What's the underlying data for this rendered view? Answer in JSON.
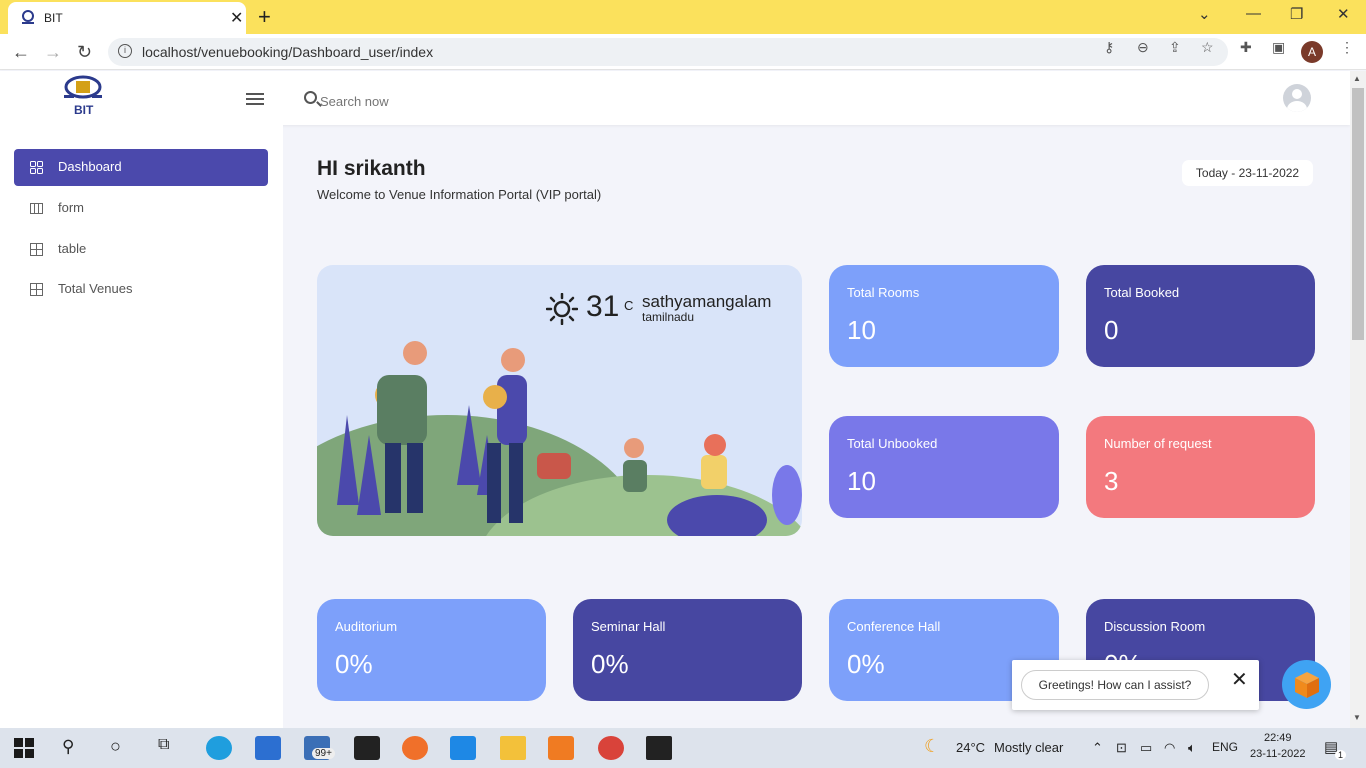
{
  "browser": {
    "tab_title": "BIT",
    "tab_close": "✕",
    "new_tab": "+",
    "url": "localhost/venuebooking/Dashboard_user/index",
    "profile_initial": "A"
  },
  "header": {
    "logo_text": "BIT",
    "search_placeholder": "Search now"
  },
  "sidebar": {
    "items": [
      {
        "label": "Dashboard",
        "icon": "grid-icon",
        "active": true
      },
      {
        "label": "form",
        "icon": "columns-icon"
      },
      {
        "label": "table",
        "icon": "table-grid-icon"
      },
      {
        "label": "Total Venues",
        "icon": "table-grid-icon"
      }
    ]
  },
  "main": {
    "greeting": "HI srikanth",
    "welcome": "Welcome to Venue Information Portal (VIP portal)",
    "date_badge": "Today - 23-11-2022",
    "weather": {
      "temp": "31",
      "unit": "C",
      "city": "sathyamangalam",
      "state": "tamilnadu",
      "icon": "sun-icon"
    },
    "stats": [
      {
        "title": "Total Rooms",
        "value": "10",
        "color": "#7da0fa"
      },
      {
        "title": "Total Booked",
        "value": "0",
        "color": "#4747a1"
      },
      {
        "title": "Total Unbooked",
        "value": "10",
        "color": "#7978e9"
      },
      {
        "title": "Number of request",
        "value": "3",
        "color": "#f3797e"
      }
    ],
    "venues": [
      {
        "title": "Auditorium",
        "value": "0%",
        "color": "#7da0fa"
      },
      {
        "title": "Seminar Hall",
        "value": "0%",
        "color": "#4747a1"
      },
      {
        "title": "Conference Hall",
        "value": "0%",
        "color": "#7da0fa"
      },
      {
        "title": "Discussion Room",
        "value": "0%",
        "color": "#4747a1"
      }
    ]
  },
  "chat": {
    "greeting": "Greetings! How can I assist?",
    "close": "✕"
  },
  "taskbar": {
    "badge": "99+",
    "weather_temp": "24°C",
    "weather_text": "Mostly clear",
    "lang": "ENG",
    "time": "22:49",
    "date": "23-11-2022",
    "notif_count": "1"
  }
}
